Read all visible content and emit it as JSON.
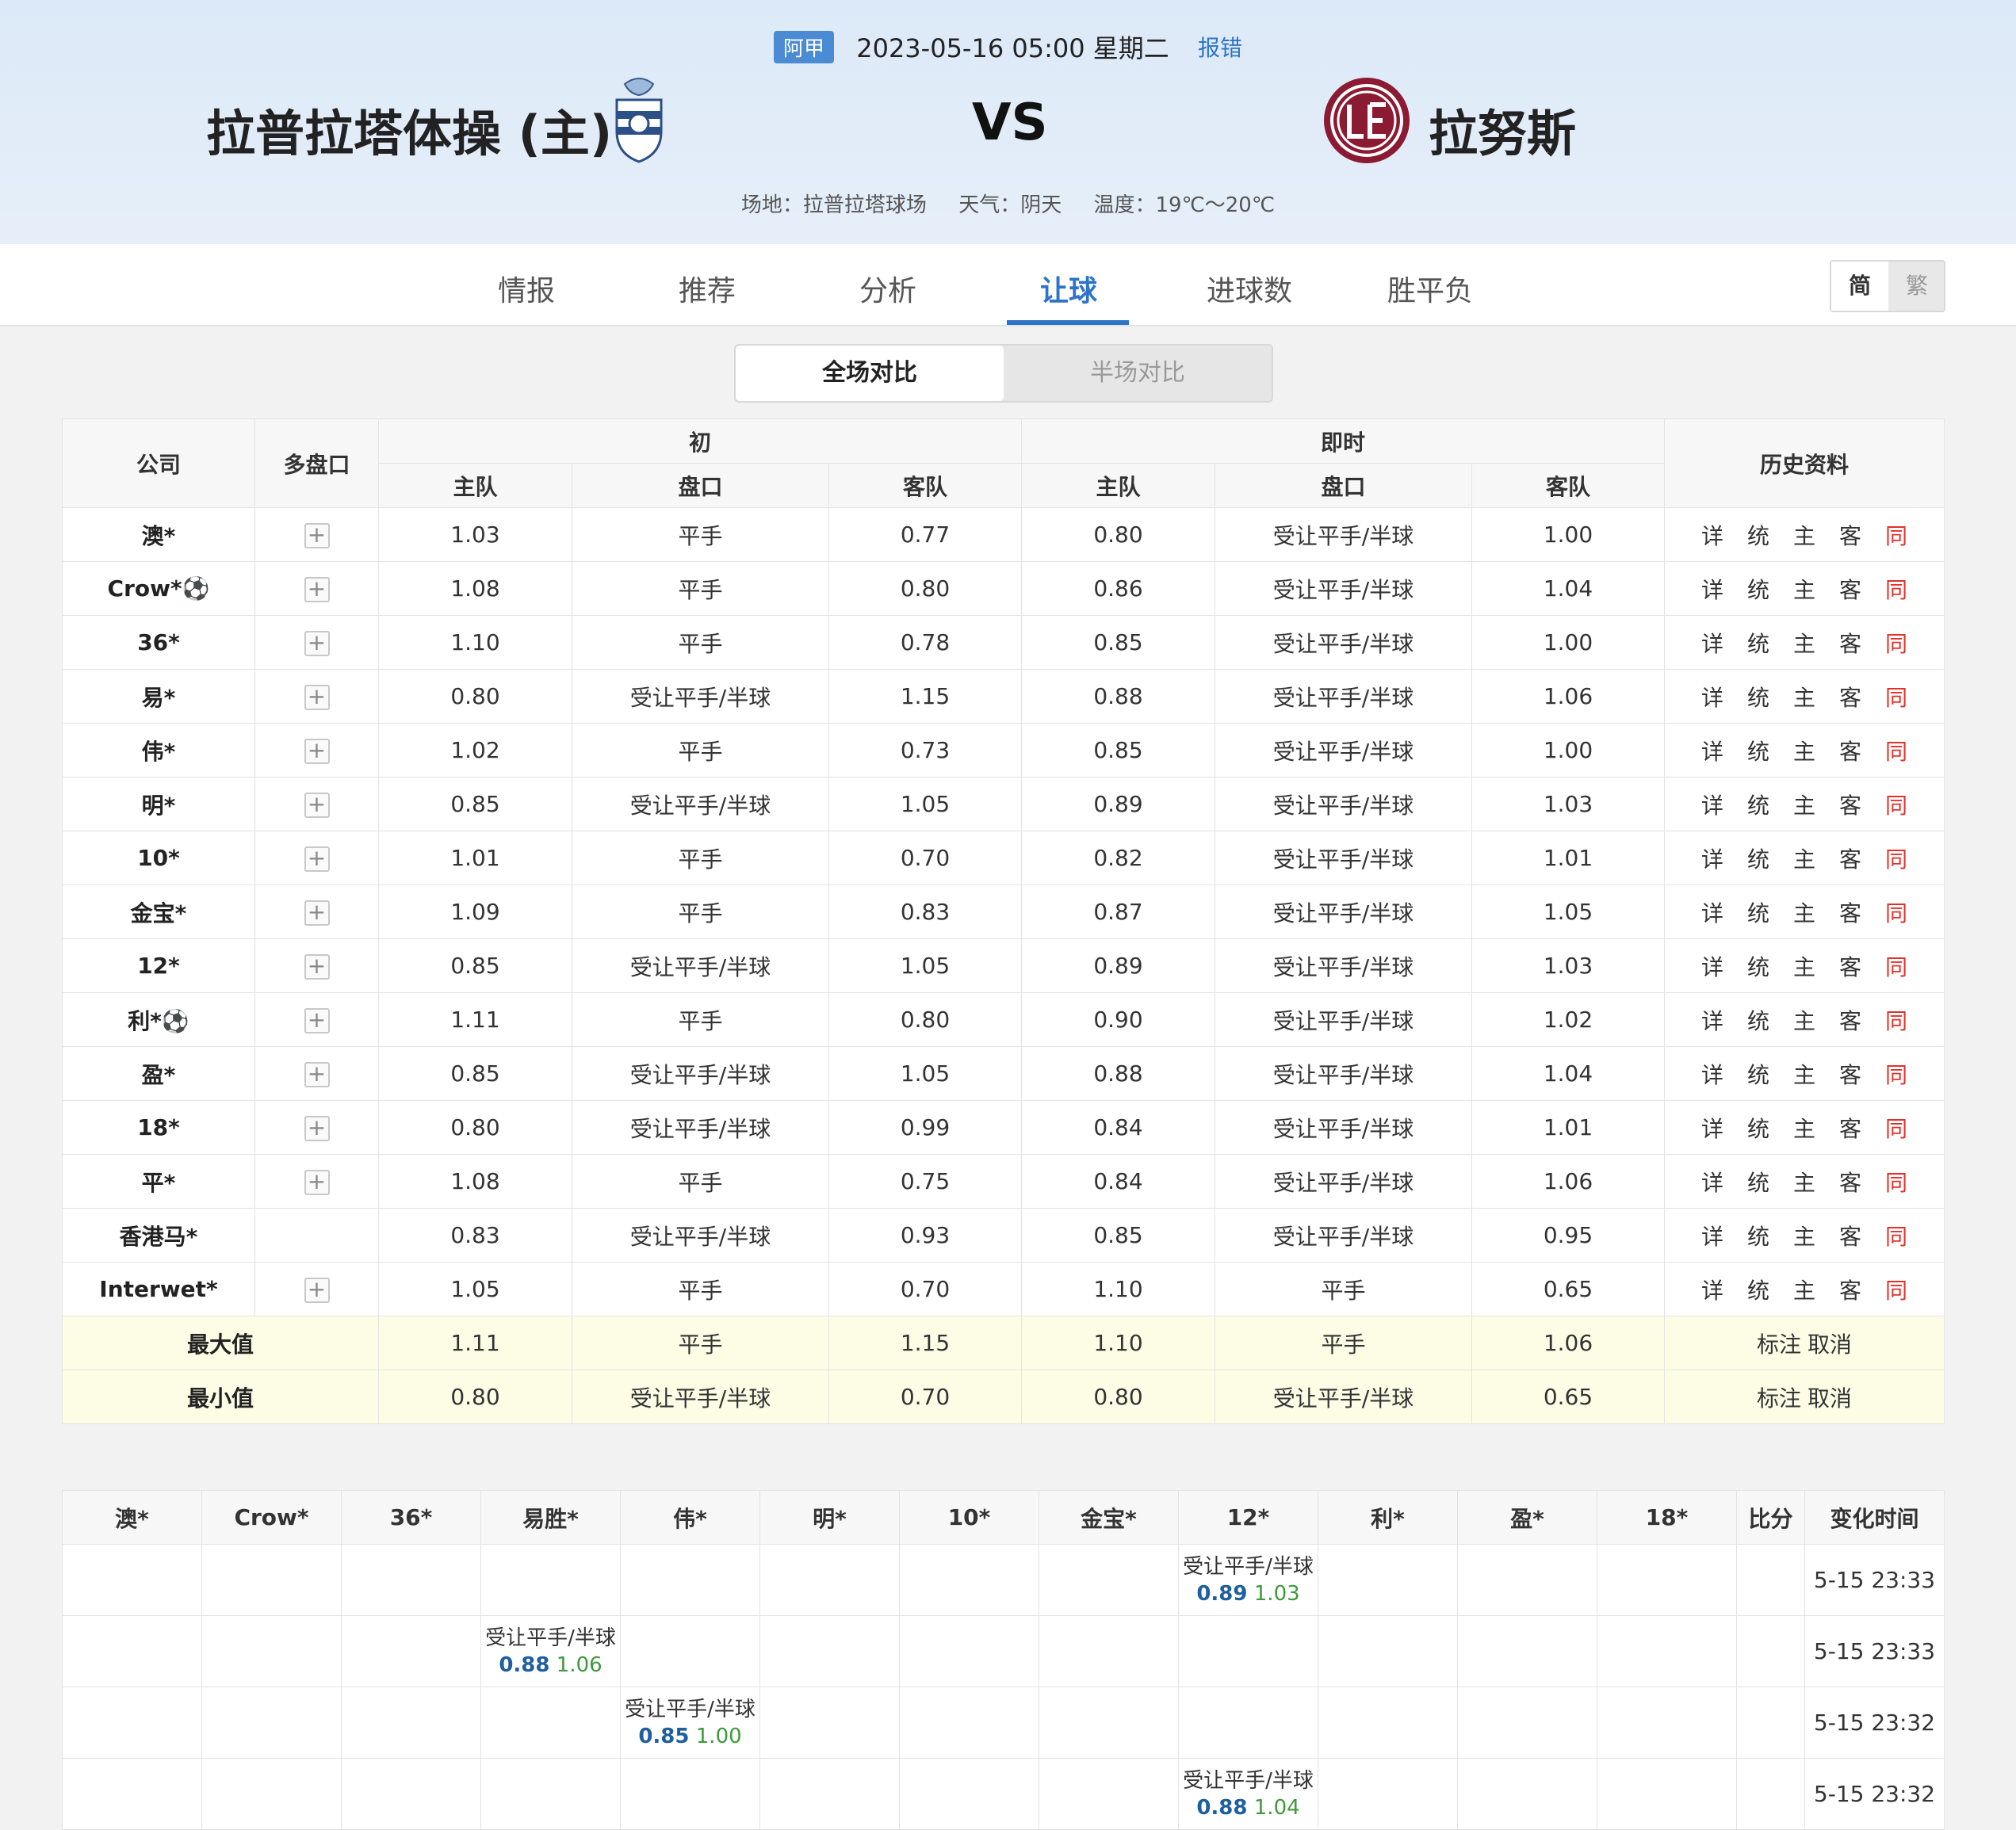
{
  "match": {
    "league": "阿甲",
    "datetime": "2023-05-16 05:00 星期二",
    "report": "报错",
    "home_team": "拉普拉塔体操 (主)",
    "away_team": "拉努斯",
    "vs": "VS",
    "venue": "场地：拉普拉塔球场",
    "weather": "天气：阴天",
    "temperature": "温度：19℃～20℃"
  },
  "tabs": [
    "情报",
    "推荐",
    "分析",
    "让球",
    "进球数",
    "胜平负"
  ],
  "active_tab": "让球",
  "lang": {
    "simplified": "简",
    "traditional": "繁"
  },
  "compare": {
    "full": "全场对比",
    "half": "半场对比"
  },
  "table_headers": {
    "company": "公司",
    "multi": "多盘口",
    "initial": "初",
    "live": "即时",
    "history": "历史资料",
    "home": "主队",
    "handicap": "盘口",
    "away": "客队"
  },
  "history_links": [
    "详",
    "统",
    "主",
    "客",
    "同"
  ],
  "rows": [
    {
      "company": "澳*",
      "plus": true,
      "i_home": "1.03",
      "i_pan": "平手",
      "i_away": "0.77",
      "l_home": "0.80",
      "l_pan": "受让平手/半球",
      "l_away": "1.00"
    },
    {
      "company": "Crow*⚽",
      "plus": true,
      "i_home": "1.08",
      "i_pan": "平手",
      "i_away": "0.80",
      "l_home": "0.86",
      "l_pan": "受让平手/半球",
      "l_away": "1.04"
    },
    {
      "company": "36*",
      "plus": true,
      "i_home": "1.10",
      "i_pan": "平手",
      "i_away": "0.78",
      "l_home": "0.85",
      "l_pan": "受让平手/半球",
      "l_away": "1.00"
    },
    {
      "company": "易*",
      "plus": true,
      "i_home": "0.80",
      "i_pan": "受让平手/半球",
      "i_away": "1.15",
      "l_home": "0.88",
      "l_pan": "受让平手/半球",
      "l_away": "1.06"
    },
    {
      "company": "伟*",
      "plus": true,
      "i_home": "1.02",
      "i_pan": "平手",
      "i_away": "0.73",
      "l_home": "0.85",
      "l_pan": "受让平手/半球",
      "l_away": "1.00"
    },
    {
      "company": "明*",
      "plus": true,
      "i_home": "0.85",
      "i_pan": "受让平手/半球",
      "i_away": "1.05",
      "l_home": "0.89",
      "l_pan": "受让平手/半球",
      "l_away": "1.03"
    },
    {
      "company": "10*",
      "plus": true,
      "i_home": "1.01",
      "i_pan": "平手",
      "i_away": "0.70",
      "l_home": "0.82",
      "l_pan": "受让平手/半球",
      "l_away": "1.01"
    },
    {
      "company": "金宝*",
      "plus": true,
      "i_home": "1.09",
      "i_pan": "平手",
      "i_away": "0.83",
      "l_home": "0.87",
      "l_pan": "受让平手/半球",
      "l_away": "1.05"
    },
    {
      "company": "12*",
      "plus": true,
      "i_home": "0.85",
      "i_pan": "受让平手/半球",
      "i_away": "1.05",
      "l_home": "0.89",
      "l_pan": "受让平手/半球",
      "l_away": "1.03"
    },
    {
      "company": "利*⚽",
      "plus": true,
      "i_home": "1.11",
      "i_pan": "平手",
      "i_away": "0.80",
      "l_home": "0.90",
      "l_pan": "受让平手/半球",
      "l_away": "1.02"
    },
    {
      "company": "盈*",
      "plus": true,
      "i_home": "0.85",
      "i_pan": "受让平手/半球",
      "i_away": "1.05",
      "l_home": "0.88",
      "l_pan": "受让平手/半球",
      "l_away": "1.04"
    },
    {
      "company": "18*",
      "plus": true,
      "i_home": "0.80",
      "i_pan": "受让平手/半球",
      "i_away": "0.99",
      "l_home": "0.84",
      "l_pan": "受让平手/半球",
      "l_away": "1.01"
    },
    {
      "company": "平*",
      "plus": true,
      "i_home": "1.08",
      "i_pan": "平手",
      "i_away": "0.75",
      "l_home": "0.84",
      "l_pan": "受让平手/半球",
      "l_away": "1.06"
    },
    {
      "company": "香港马*",
      "plus": false,
      "i_home": "0.83",
      "i_pan": "受让平手/半球",
      "i_away": "0.93",
      "l_home": "0.85",
      "l_pan": "受让平手/半球",
      "l_away": "0.95"
    },
    {
      "company": "Interwet*",
      "plus": true,
      "i_home": "1.05",
      "i_pan": "平手",
      "i_away": "0.70",
      "l_home": "1.10",
      "l_pan": "平手",
      "l_away": "0.65"
    }
  ],
  "summary": [
    {
      "label": "最大值",
      "i_home": "1.11",
      "i_pan": "平手",
      "i_away": "1.15",
      "l_home": "1.10",
      "l_pan": "平手",
      "l_away": "1.06",
      "mark": "标注",
      "cancel": "取消"
    },
    {
      "label": "最小值",
      "i_home": "0.80",
      "i_pan": "受让平手/半球",
      "i_away": "0.70",
      "l_home": "0.80",
      "l_pan": "受让平手/半球",
      "l_away": "0.65",
      "mark": "标注",
      "cancel": "取消"
    }
  ],
  "change_headers": [
    "澳*",
    "Crow*",
    "36*",
    "易胜*",
    "伟*",
    "明*",
    "10*",
    "金宝*",
    "12*",
    "利*",
    "盈*",
    "18*",
    "比分",
    "变化时间"
  ],
  "changes": [
    {
      "col": 8,
      "pan": "受让平手/半球",
      "home": "0.89",
      "away": "1.03",
      "time": "5-15 23:33"
    },
    {
      "col": 3,
      "pan": "受让平手/半球",
      "home": "0.88",
      "away": "1.06",
      "time": "5-15 23:33"
    },
    {
      "col": 4,
      "pan": "受让平手/半球",
      "home": "0.85",
      "away": "1.00",
      "time": "5-15 23:32"
    },
    {
      "col": 8,
      "pan": "受让平手/半球",
      "home": "0.88",
      "away": "1.04",
      "time": "5-15 23:32"
    }
  ]
}
